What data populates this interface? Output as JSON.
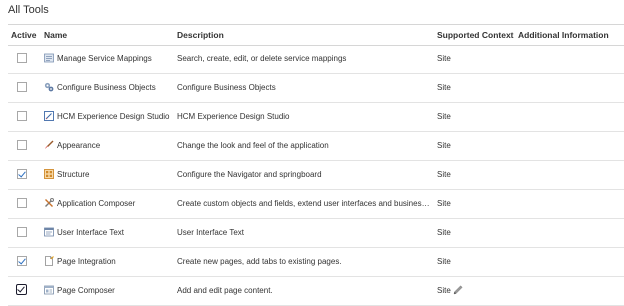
{
  "section": {
    "title": "All Tools"
  },
  "columns": {
    "active": "Active",
    "name": "Name",
    "description": "Description",
    "context": "Supported Context",
    "info": "Additional Information"
  },
  "rows": [
    {
      "name": "Manage Service Mappings",
      "description": "Search, create, edit, or delete service mappings",
      "context": "Site",
      "active": false,
      "icon": "service-mappings-icon"
    },
    {
      "name": "Configure Business Objects",
      "description": "Configure Business Objects",
      "context": "Site",
      "active": false,
      "icon": "business-objects-icon"
    },
    {
      "name": "HCM Experience Design Studio",
      "description": "HCM Experience Design Studio",
      "context": "Site",
      "active": false,
      "icon": "design-studio-icon"
    },
    {
      "name": "Appearance",
      "description": "Change the look and feel of the application",
      "context": "Site",
      "active": false,
      "icon": "paintbrush-icon"
    },
    {
      "name": "Structure",
      "description": "Configure the Navigator and springboard",
      "context": "Site",
      "active": true,
      "icon": "structure-icon"
    },
    {
      "name": "Application Composer",
      "description": "Create custom objects and fields, extend user interfaces and business lo...",
      "context": "Site",
      "active": false,
      "icon": "tools-icon"
    },
    {
      "name": "User Interface Text",
      "description": "User Interface Text",
      "context": "Site",
      "active": false,
      "icon": "ui-text-icon"
    },
    {
      "name": "Page Integration",
      "description": "Create new pages, add tabs to existing pages.",
      "context": "Site",
      "active": true,
      "icon": "page-integration-icon"
    },
    {
      "name": "Page Composer",
      "description": "Add and edit page content.",
      "context": "Site",
      "active": true,
      "focused": true,
      "icon": "page-composer-icon",
      "context_edit_icon": "pencil-icon"
    }
  ]
}
